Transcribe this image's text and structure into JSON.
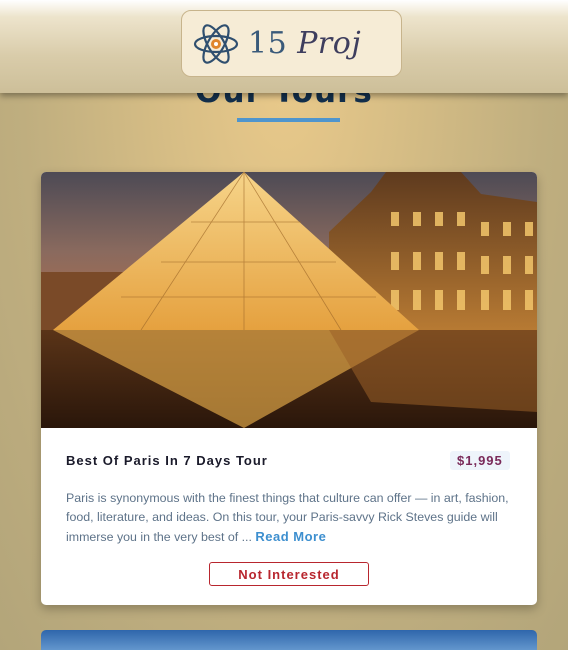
{
  "header": {
    "logo_number": "15",
    "logo_script": "Proj"
  },
  "page": {
    "title": "Our Tours"
  },
  "tours": [
    {
      "name": "Best Of Paris In 7 Days Tour",
      "price": "$1,995",
      "description": "Paris is synonymous with the finest things that culture can offer — in art, fashion, food, literature, and ideas. On this tour, your Paris-savvy Rick Steves guide will immerse you in the very best of ...",
      "read_more_label": "Read More",
      "not_interested_label": "Not Interested"
    }
  ],
  "colors": {
    "accent": "#4f95cd",
    "title": "#132f4c",
    "price": "#7a2a5a",
    "danger": "#b8262e"
  },
  "icons": {
    "logo": "atom-icon"
  }
}
